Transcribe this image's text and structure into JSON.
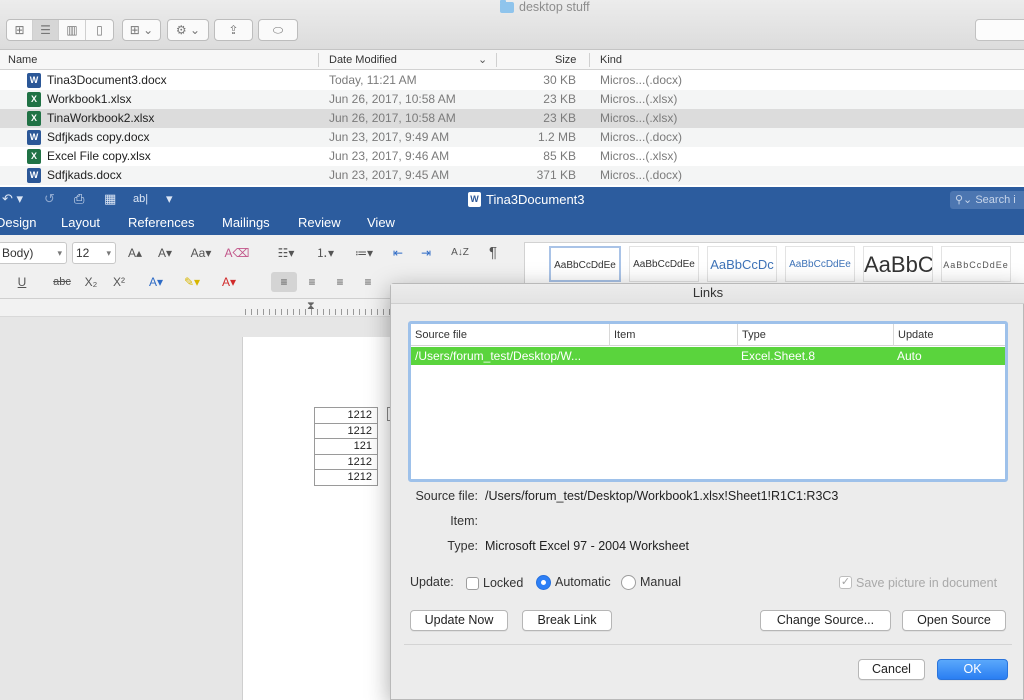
{
  "finder": {
    "title": "desktop stuff",
    "toolbar": {
      "view_icons": "⊞",
      "view_list": "☰",
      "view_columns": "▥",
      "view_gallery": "▯",
      "arrange": "⊞ ⌄",
      "action": "⚙ ⌄",
      "share": "⇪",
      "tags": "⬭"
    },
    "columns": {
      "name": "Name",
      "date": "Date Modified",
      "size": "Size",
      "kind": "Kind"
    },
    "sort_indicator": "⌄",
    "files": [
      {
        "name": "Tina3Document3.docx",
        "date": "Today, 11:21 AM",
        "size": "30 KB",
        "kind": "Micros...(.docx)",
        "icon": "word-doc-icon",
        "badge": "W",
        "selected": false
      },
      {
        "name": "Workbook1.xlsx",
        "date": "Jun 26, 2017, 10:58 AM",
        "size": "23 KB",
        "kind": "Micros...(.xlsx)",
        "icon": "excel-doc-icon",
        "badge": "X",
        "selected": false
      },
      {
        "name": "TinaWorkbook2.xlsx",
        "date": "Jun 26, 2017, 10:58 AM",
        "size": "23 KB",
        "kind": "Micros...(.xlsx)",
        "icon": "excel-doc-icon",
        "badge": "X",
        "selected": true
      },
      {
        "name": "Sdfjkads copy.docx",
        "date": "Jun 23, 2017, 9:49 AM",
        "size": "1.2 MB",
        "kind": "Micros...(.docx)",
        "icon": "word-doc-icon",
        "badge": "W",
        "selected": false
      },
      {
        "name": "Excel File copy.xlsx",
        "date": "Jun 23, 2017, 9:46 AM",
        "size": "85 KB",
        "kind": "Micros...(.xlsx)",
        "icon": "excel-doc-icon",
        "badge": "X",
        "selected": false
      },
      {
        "name": "Sdfjkads.docx",
        "date": "Jun 23, 2017, 9:45 AM",
        "size": "371 KB",
        "kind": "Micros...(.docx)",
        "icon": "word-doc-icon",
        "badge": "W",
        "selected": false
      }
    ]
  },
  "word": {
    "title": "Tina3Document3",
    "badge": "W",
    "search_placeholder": "Search i",
    "quick_access": {
      "undo": "↶ ▾",
      "redo": "↺",
      "print": "⎙",
      "grid": "▦",
      "abl": "ab|",
      "customize": "▾"
    },
    "tabs": [
      "Design",
      "Layout",
      "References",
      "Mailings",
      "Review",
      "View"
    ],
    "ribbon": {
      "font_name": "Body)",
      "font_size": "12",
      "grow_font": "A▴",
      "shrink_font": "A▾",
      "change_case": "Aa▾",
      "clear_format": "A⌫",
      "bullets": "☷▾",
      "numbering": "⒈▾",
      "multilevel": "≔▾",
      "decrease_indent": "⇤",
      "increase_indent": "⇥",
      "sort": "A↓Z",
      "pilcrow": "¶",
      "underline": "U",
      "strikethrough": "abc",
      "subscript": "X₂",
      "superscript": "X²",
      "text_effects": "A▾",
      "highlight": "✎▾",
      "font_color": "A▾",
      "align_left": "≡",
      "align_center": "≡",
      "align_right": "≡",
      "justify": "≡"
    },
    "styles": [
      "AaBbCcDdEe",
      "AaBbCcDdEe",
      "AaBbCcDc",
      "AaBbCcDdEe",
      "AaBbC",
      "AaBbCcDdEe"
    ],
    "table_values": [
      "1212",
      "1212",
      "121",
      "1212",
      "1212"
    ]
  },
  "links_dialog": {
    "title": "Links",
    "columns": {
      "source": "Source file",
      "item": "Item",
      "type": "Type",
      "update": "Update"
    },
    "row": {
      "source": "/Users/forum_test/Desktop/W...",
      "item": "",
      "type": "Excel.Sheet.8",
      "update": "Auto"
    },
    "labels": {
      "source_file": "Source file:",
      "item": "Item:",
      "type": "Type:",
      "update": "Update:"
    },
    "values": {
      "source_file": "/Users/forum_test/Desktop/Workbook1.xlsx!Sheet1!R1C1:R3C3",
      "item": "",
      "type": "Microsoft Excel 97 - 2004 Worksheet"
    },
    "options": {
      "locked": "Locked",
      "automatic": "Automatic",
      "manual": "Manual",
      "save_picture": "Save picture in document"
    },
    "checkmark": "✓",
    "buttons": {
      "update_now": "Update Now",
      "break_link": "Break Link",
      "change_source": "Change Source...",
      "open_source": "Open Source",
      "cancel": "Cancel",
      "ok": "OK"
    },
    "highlight_color": "#5ad43d",
    "accent_color": "#2d7ff6"
  }
}
